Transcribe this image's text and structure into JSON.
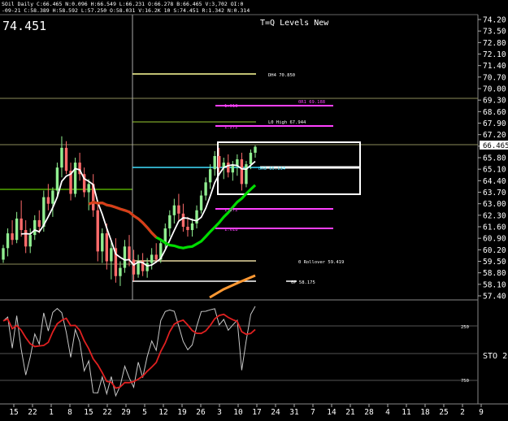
{
  "header": {
    "line1": "SOil Daily C:66.465 N:0.096 H:66.549 L:66.231 O:66.278 B:66.465 V:3,702 OI:0",
    "line2": "-09-21 C:58.389 H:58.592 L:57.250 O:58.031 V:16.2K 10 S:74.451 R:1.342 N:0.314",
    "big_price": "74.451"
  },
  "title": "T=Q Levels New",
  "price_axis": {
    "labels": [
      "74.20",
      "73.50",
      "72.80",
      "72.10",
      "71.40",
      "70.70",
      "70.00",
      "69.30",
      "68.60",
      "67.90",
      "67.20",
      "66.50",
      "65.80",
      "65.10",
      "64.40",
      "63.70",
      "63.00",
      "62.30",
      "61.60",
      "60.90",
      "60.20",
      "59.50",
      "58.80",
      "58.10",
      "57.40"
    ],
    "current_price_tag": "66.465"
  },
  "indicator": {
    "label": "STO 2",
    "levels": [
      "250",
      "750"
    ]
  },
  "date_axis": {
    "labels": [
      "15",
      "22",
      "1",
      "8",
      "15",
      "22",
      "29",
      "5",
      "12",
      "19",
      "26",
      "3",
      "10",
      "17",
      "24",
      "31",
      "7",
      "14",
      "21",
      "28",
      "4",
      "11",
      "18",
      "25",
      "2",
      "9"
    ]
  },
  "levels": [
    {
      "text": "DH4 70.850",
      "color": "#ffffff"
    },
    {
      "text": "0R1 69.188",
      "color": "#ff40ff"
    },
    {
      "text": "1.618",
      "color": "#ff40ff"
    },
    {
      "text": "L0 High 67.944",
      "color": "#ffffff"
    },
    {
      "text": "1.272",
      "color": "#ff40ff"
    },
    {
      "text": "DH3 65.134",
      "color": "#00ffff"
    },
    {
      "text": "1.272",
      "color": "#ff40ff"
    },
    {
      "text": "1.618",
      "color": "#ff40ff"
    },
    {
      "text": "0 Rollover 59.419",
      "color": "#ffffff"
    },
    {
      "text": "0P 58.175",
      "color": "#ffffff"
    }
  ],
  "colors": {
    "bull_candle": "#90ee90",
    "bear_candle": "#ff6b6b",
    "ma_white": "#ffffff",
    "ma_green": "#00dd00",
    "ma_red": "#ff2020",
    "ma_orange": "#ff9933",
    "level_magenta": "#ff40ff",
    "level_cyan": "#40e0ff",
    "level_yellow": "#ffff99"
  },
  "chart_data": {
    "type": "candlestick",
    "yaxis_range": [
      57.4,
      74.2
    ],
    "candles": [
      [
        59.6,
        60.5,
        59.4,
        60.3
      ],
      [
        60.3,
        61.5,
        59.8,
        61.2
      ],
      [
        61.2,
        62.0,
        60.5,
        60.8
      ],
      [
        60.8,
        62.5,
        60.6,
        62.1
      ],
      [
        62.1,
        63.2,
        61.0,
        61.4
      ],
      [
        61.4,
        62.0,
        60.0,
        60.4
      ],
      [
        60.4,
        61.5,
        60.0,
        61.1
      ],
      [
        61.1,
        62.3,
        60.8,
        62.0
      ],
      [
        62.0,
        62.6,
        61.2,
        61.6
      ],
      [
        61.6,
        63.8,
        61.3,
        63.4
      ],
      [
        63.4,
        64.2,
        62.6,
        63.0
      ],
      [
        63.0,
        64.0,
        62.2,
        63.8
      ],
      [
        63.8,
        65.5,
        63.5,
        65.2
      ],
      [
        65.2,
        67.1,
        64.6,
        66.4
      ],
      [
        66.4,
        66.8,
        64.8,
        65.0
      ],
      [
        65.0,
        65.5,
        63.2,
        63.6
      ],
      [
        63.6,
        65.8,
        63.4,
        65.5
      ],
      [
        65.5,
        66.1,
        64.4,
        64.8
      ],
      [
        64.8,
        65.2,
        63.4,
        63.7
      ],
      [
        63.7,
        64.5,
        62.6,
        64.2
      ],
      [
        64.2,
        64.8,
        62.2,
        62.6
      ],
      [
        62.6,
        63.1,
        59.5,
        60.1
      ],
      [
        60.1,
        61.5,
        59.4,
        61.2
      ],
      [
        61.2,
        61.8,
        59.0,
        59.5
      ],
      [
        59.5,
        60.8,
        58.4,
        60.3
      ],
      [
        60.3,
        60.9,
        58.2,
        58.6
      ],
      [
        58.6,
        59.5,
        58.0,
        59.1
      ],
      [
        59.1,
        60.8,
        58.8,
        60.4
      ],
      [
        60.4,
        61.1,
        59.2,
        59.6
      ],
      [
        59.6,
        60.2,
        58.3,
        58.7
      ],
      [
        58.7,
        59.9,
        58.5,
        59.5
      ],
      [
        59.5,
        60.0,
        58.6,
        58.9
      ],
      [
        58.9,
        59.7,
        58.5,
        59.4
      ],
      [
        59.4,
        60.3,
        59.0,
        59.9
      ],
      [
        59.9,
        60.6,
        59.4,
        59.6
      ],
      [
        59.6,
        60.8,
        59.4,
        60.6
      ],
      [
        60.6,
        61.8,
        60.3,
        61.5
      ],
      [
        61.5,
        62.6,
        61.0,
        62.3
      ],
      [
        62.3,
        63.3,
        61.8,
        62.9
      ],
      [
        62.9,
        63.6,
        62.0,
        62.4
      ],
      [
        62.4,
        63.0,
        61.3,
        61.6
      ],
      [
        61.6,
        62.2,
        61.0,
        61.4
      ],
      [
        61.4,
        62.1,
        61.0,
        61.8
      ],
      [
        61.8,
        62.9,
        61.5,
        62.6
      ],
      [
        62.6,
        63.8,
        62.4,
        63.5
      ],
      [
        63.5,
        64.6,
        63.2,
        64.3
      ],
      [
        64.3,
        65.4,
        63.9,
        65.1
      ],
      [
        65.1,
        66.2,
        64.7,
        65.9
      ],
      [
        65.9,
        66.4,
        64.9,
        65.2
      ],
      [
        65.2,
        65.8,
        64.5,
        65.5
      ],
      [
        65.5,
        66.0,
        64.6,
        64.9
      ],
      [
        64.9,
        65.6,
        64.4,
        65.3
      ],
      [
        65.3,
        66.0,
        64.7,
        65.7
      ],
      [
        65.7,
        66.1,
        63.8,
        64.2
      ],
      [
        64.2,
        65.6,
        64.0,
        65.4
      ],
      [
        65.4,
        66.3,
        65.1,
        66.1
      ],
      [
        66.1,
        66.55,
        65.8,
        66.46
      ]
    ]
  }
}
